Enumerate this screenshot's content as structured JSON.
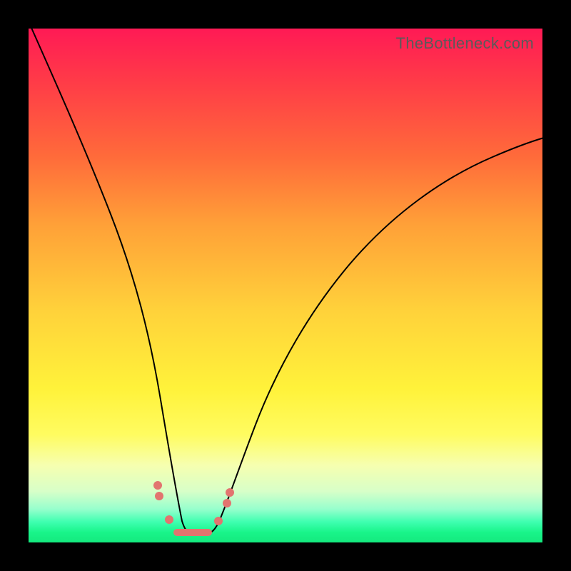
{
  "watermark": "TheBottleneck.com",
  "chart_data": {
    "type": "line",
    "title": "",
    "xlabel": "",
    "ylabel": "",
    "xlim": [
      0,
      100
    ],
    "ylim": [
      0,
      100
    ],
    "grid": false,
    "legend": false,
    "series": [
      {
        "name": "bottleneck-curve",
        "x": [
          0,
          5,
          10,
          15,
          20,
          23,
          25,
          27,
          29,
          30,
          31,
          33,
          35,
          37,
          40,
          45,
          50,
          55,
          60,
          65,
          70,
          75,
          80,
          85,
          90,
          95,
          100
        ],
        "y": [
          100,
          88,
          75,
          60,
          42,
          28,
          18,
          10,
          5,
          3,
          3,
          3,
          4,
          7,
          13,
          24,
          33,
          41,
          48,
          54,
          59,
          63,
          67,
          70,
          72,
          74,
          75
        ]
      }
    ],
    "markers": {
      "name": "highlight-dots",
      "x": [
        24.0,
        24.3,
        27.0,
        29.0,
        30.0,
        31.0,
        33.0,
        35.0,
        37.2,
        37.8
      ],
      "y": [
        17.0,
        14.5,
        5.5,
        3.2,
        3.0,
        3.0,
        3.0,
        3.5,
        10.0,
        12.5
      ]
    },
    "color_gradient": {
      "top": "#ff1a55",
      "mid_upper": "#ffa038",
      "mid": "#fff23a",
      "mid_lower": "#d8ffc8",
      "bottom": "#14e97e"
    }
  }
}
